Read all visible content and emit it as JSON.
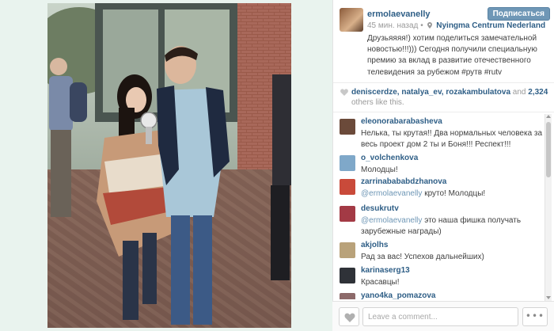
{
  "post": {
    "author": "ermolaevanelly",
    "follow_label": "Подписаться",
    "time_ago": "45 мин. назад",
    "separator": "•",
    "location": "Nyingma Centrum Nederland",
    "caption": "Друзьяяяя!) хотим поделиться замечательной новостью!!!))) Сегодня получили специальную премию за вклад в развитие отечественного телевидения за рубежом #рутв #rutv",
    "avatar_icon": "author-avatar"
  },
  "likes": {
    "likers": "deniscerdze, natalya_ev, rozakambulatova",
    "and": "and",
    "count": "2,324",
    "suffix": "others like this.",
    "heart_color": "#c8c8c8"
  },
  "comments": [
    {
      "user": "eleonorabarabasheva",
      "text": "Нелька, ты крутая!! Два нормальных человека за весь проект дом 2 ты и Боня!!! Респект!!!",
      "mention": "",
      "avatar_color": "#6b4a3a"
    },
    {
      "user": "o_volchenkova",
      "text": "Молодцы!",
      "mention": "",
      "avatar_color": "#7fa8c9"
    },
    {
      "user": "zarrinabababdzhanova",
      "mention": "@ermolaevanelly",
      "text": " круто! Молодцы!",
      "avatar_color": "#c94a3a"
    },
    {
      "user": "desukrutv",
      "mention": "@ermolaevanelly",
      "text": " это наша фишка получать зарубежные награды)",
      "avatar_color": "#a33a45"
    },
    {
      "user": "akjolhs",
      "text": "Рад за вас! Успехов дальнейших)",
      "mention": "",
      "avatar_color": "#b9a27a"
    },
    {
      "user": "karinaserg13",
      "text": "Красавцы!",
      "mention": "",
      "avatar_color": "#2f3238"
    },
    {
      "user": "yano4ka_pomazova",
      "text": "",
      "mention": "",
      "avatar_color": "#8d6a6a"
    }
  ],
  "composer": {
    "placeholder": "Leave a comment...",
    "more_label": "•••"
  },
  "colors": {
    "link": "#2e5e86",
    "button": "#6f97b6",
    "muted": "#9a9a9a",
    "photo_background": "#e9f3ee"
  }
}
